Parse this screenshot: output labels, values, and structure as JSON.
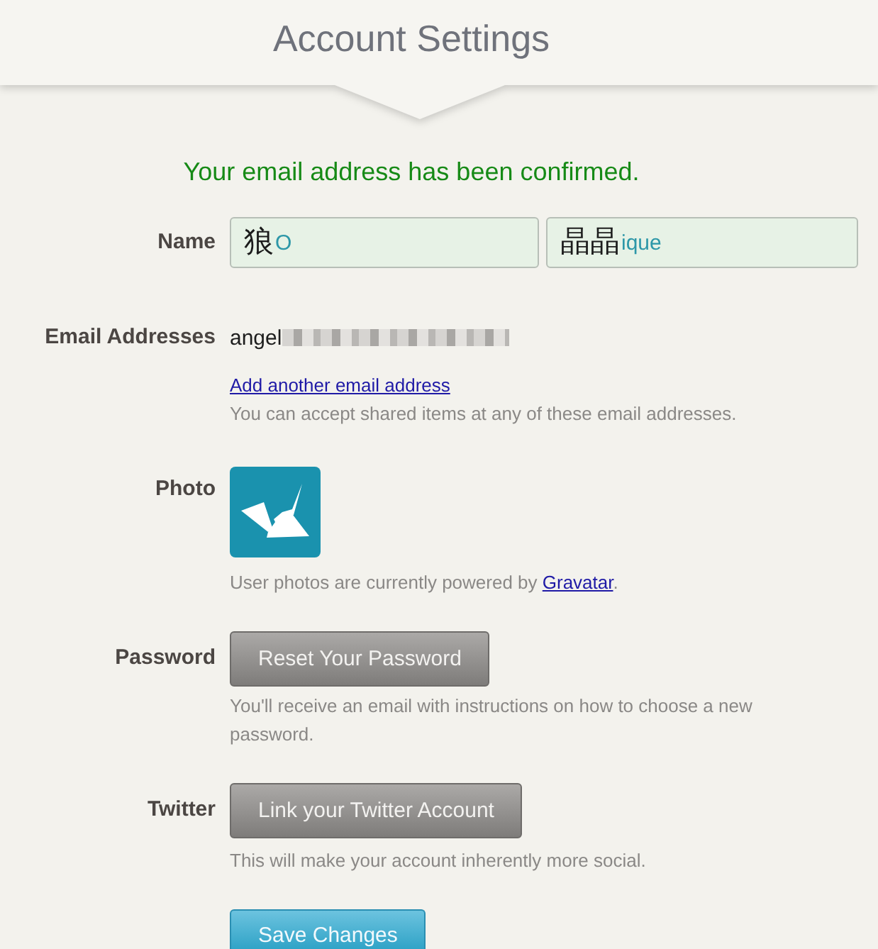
{
  "header": {
    "title": "Account Settings"
  },
  "notice": {
    "text": "Your email address has been confirmed."
  },
  "form": {
    "rows": [
      {
        "kind": "name",
        "label": "Name",
        "fields": [
          {
            "typed": "狼",
            "value": "O"
          },
          {
            "typed": "晶晶",
            "value": "ique"
          }
        ]
      },
      {
        "kind": "email",
        "label": "Email Addresses",
        "value": "angel",
        "redacted": true,
        "link": "Add another email address",
        "help": [
          {
            "text": "You can accept shared items at any of these email addresses."
          }
        ]
      },
      {
        "kind": "photo",
        "label": "Photo",
        "help": [
          {
            "text": "User photos are currently powered by "
          },
          {
            "text": "Gravatar",
            "link": true
          },
          {
            "text": "."
          }
        ]
      },
      {
        "kind": "button",
        "label": "Password",
        "button": "Reset Your Password",
        "help": [
          {
            "text": "You'll receive an email with instructions on how to choose a new password."
          }
        ]
      },
      {
        "kind": "button",
        "label": "Twitter",
        "button": "Link your Twitter Account",
        "help": [
          {
            "text": "This will make your account inherently more social."
          }
        ]
      }
    ],
    "submit": "Save Changes"
  }
}
